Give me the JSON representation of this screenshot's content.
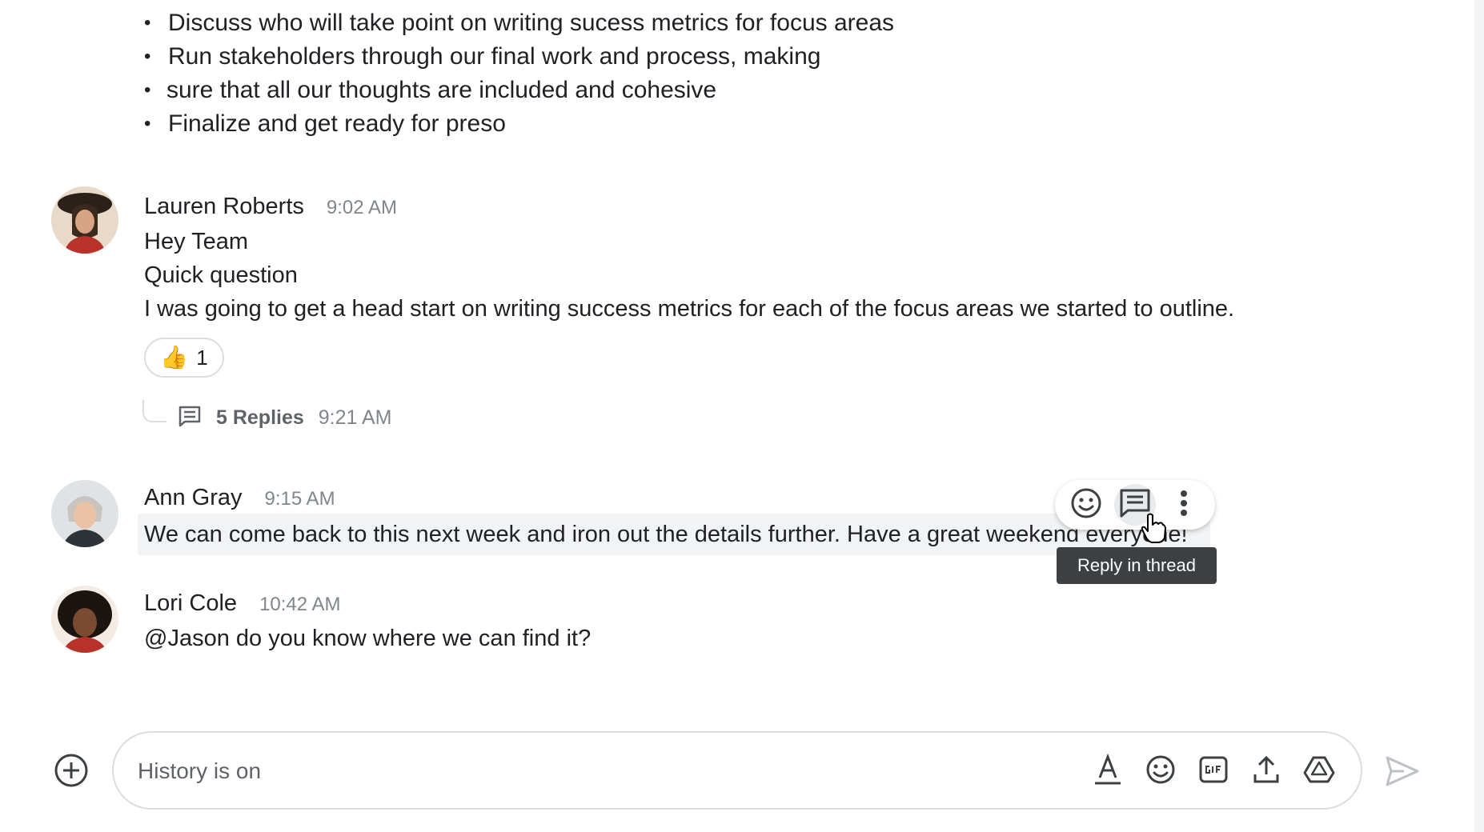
{
  "previous_message": {
    "bullets": [
      "Discuss who will take point on writing sucess metrics for focus areas",
      "Run stakeholders through our final work and process, making",
      "sure that all our thoughts are included and cohesive",
      "Finalize and get ready for preso"
    ]
  },
  "messages": [
    {
      "author": "Lauren Roberts",
      "time": "9:02 AM",
      "lines": [
        "Hey Team",
        "Quick question",
        "I was going to get a head start on writing success metrics for each of the focus areas we started to outline."
      ],
      "reaction": {
        "emoji": "👍",
        "count": "1"
      },
      "thread": {
        "replies": "5 Replies",
        "time": "9:21 AM"
      }
    },
    {
      "author": "Ann Gray",
      "time": "9:15 AM",
      "lines": [
        "We can come back to this next week and iron out the details further. Have a great weekend everyone!"
      ]
    },
    {
      "author": "Lori Cole",
      "time": "10:42 AM",
      "lines": [
        "@Jason do you know where we can find it?"
      ]
    }
  ],
  "hover_toolbar": {
    "buttons": [
      "add-reaction-icon",
      "reply-in-thread-icon",
      "more-options-icon"
    ],
    "tooltip": "Reply in thread"
  },
  "composer": {
    "placeholder": "History is on",
    "tools": [
      "format-text-icon",
      "emoji-icon",
      "gif-icon",
      "upload-icon",
      "drive-icon"
    ]
  },
  "colors": {
    "text": "#202124",
    "muted": "#80868b",
    "border": "#dadce0",
    "highlight": "#f1f3f4",
    "tooltip_bg": "#3c4043"
  }
}
